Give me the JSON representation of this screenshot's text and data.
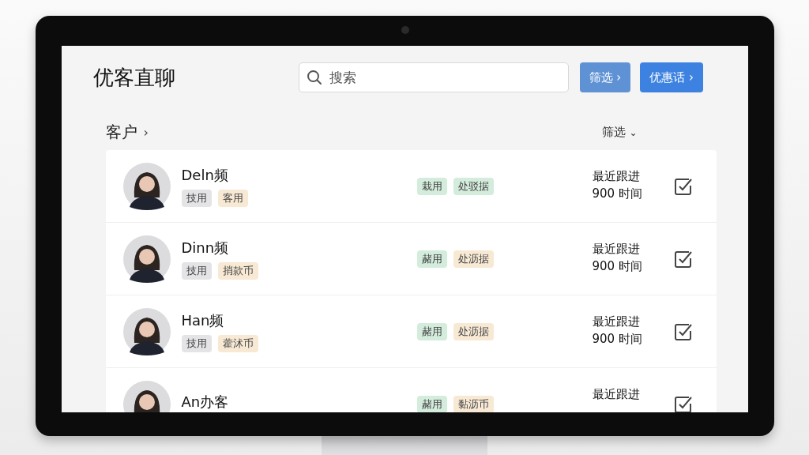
{
  "app_title": "优客直聊",
  "search": {
    "placeholder": "搜索"
  },
  "buttons": [
    {
      "label": "筛选 ›",
      "kind": "secondary"
    },
    {
      "label": "优惠话 ›",
      "kind": "primary"
    }
  ],
  "section": {
    "title": "客户",
    "chevron": "›",
    "sort": "筛选",
    "sort_caret": "⌄"
  },
  "customers": [
    {
      "name": "Deln频",
      "tags": [
        {
          "label": "技用",
          "color": "#e4e4e7"
        },
        {
          "label": "客用",
          "color": "#f7e9d4"
        }
      ],
      "labels": [
        {
          "label": "栽用",
          "color": "#d3ecdc"
        },
        {
          "label": "处驳据",
          "color": "#d3ecdc"
        }
      ],
      "follow_up": "最近跟进",
      "time": "900 时间",
      "checked": true
    },
    {
      "name": "Dinn频",
      "tags": [
        {
          "label": "技用",
          "color": "#e4e4e7"
        },
        {
          "label": "捎款币",
          "color": "#f7e9d4"
        }
      ],
      "labels": [
        {
          "label": "赭用",
          "color": "#d3ecdc"
        },
        {
          "label": "处沥据",
          "color": "#f7e9d4"
        }
      ],
      "follow_up": "最近跟进",
      "time": "900 时间",
      "checked": true
    },
    {
      "name": "Han频",
      "tags": [
        {
          "label": "技用",
          "color": "#e4e4e7"
        },
        {
          "label": "藿沭币",
          "color": "#f7e9d4"
        }
      ],
      "labels": [
        {
          "label": "赭用",
          "color": "#d3ecdc"
        },
        {
          "label": "处沥据",
          "color": "#f7e9d4"
        }
      ],
      "follow_up": "最近跟进",
      "time": "900 时间",
      "checked": true
    },
    {
      "name": "An办客",
      "labels": [
        {
          "label": "赭用",
          "color": "#d3ecdc"
        },
        {
          "label": "黏沥币",
          "color": "#f7e9d4"
        }
      ],
      "follow_up": "最近跟进",
      "checked": true
    }
  ]
}
